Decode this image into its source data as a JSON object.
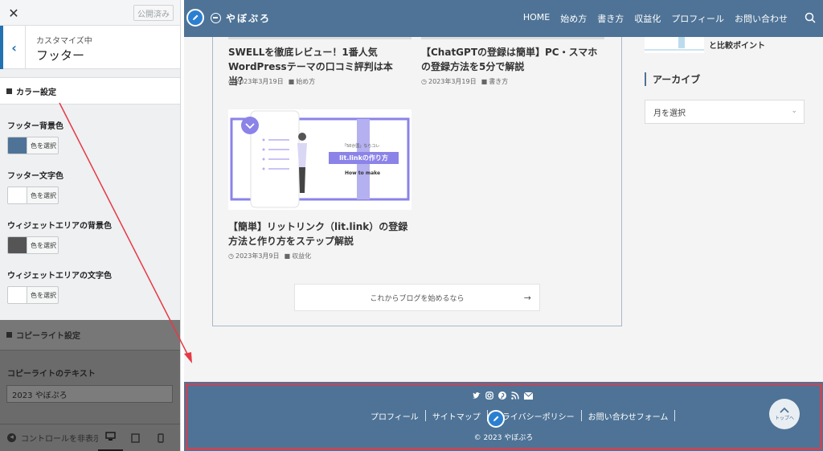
{
  "customizer": {
    "publish_label": "公開済み",
    "subtitle": "カスタマイズ中",
    "title": "フッター",
    "color_section": "カラー設定",
    "fields": [
      {
        "label": "フッター背景色",
        "button": "色を選択",
        "color": "#4e7396"
      },
      {
        "label": "フッター文字色",
        "button": "色を選択",
        "color": "#ffffff"
      },
      {
        "label": "ウィジェットエリアの背景色",
        "button": "色を選択",
        "color": "#555555"
      },
      {
        "label": "ウィジェットエリアの文字色",
        "button": "色を選択",
        "color": "#ffffff"
      }
    ],
    "copyright_section": "コピーライト設定",
    "copyright_label": "コピーライトのテキスト",
    "copyright_value": "2023 やぼぷろ",
    "hide_controls": "コントロールを非表示"
  },
  "site": {
    "logo": "やぼぷろ",
    "nav": [
      "HOME",
      "始め方",
      "書き方",
      "収益化",
      "プロフィール",
      "お問い合わせ"
    ],
    "posts": [
      {
        "title": "SWELLを徹底レビュー！1番人気WordPressテーマの口コミ評判は本当？",
        "date": "2023年3月19日",
        "category": "始め方"
      },
      {
        "title": "【ChatGPTの登録は簡単】PC・スマホの登録方法を5分で解説",
        "date": "2023年3月19日",
        "category": "書き方"
      },
      {
        "title": "【簡単】リットリンク（lit.link）の登録方法と作り方をステップ解説",
        "date": "2023年3月9日",
        "category": "収益化"
      }
    ],
    "thumb": {
      "small": "「50か国」ならコレ",
      "banner": "lit.linkの作り方",
      "sub": "How to make"
    },
    "more_button": "これからブログを始めるなら",
    "sidebar": {
      "widget_text": "と比較ポイント",
      "archive_title": "アーカイブ",
      "month_select": "月を選択"
    },
    "footer": {
      "links": [
        "プロフィール",
        "サイトマップ",
        "プライバシーポリシー",
        "お問い合わせフォーム"
      ],
      "copyright": "© 2023 やぼぷろ",
      "totop_label": "トップへ"
    }
  },
  "colors": {
    "header": "#4e7396",
    "accent": "#2b7fd0",
    "highlight": "#e63946"
  }
}
